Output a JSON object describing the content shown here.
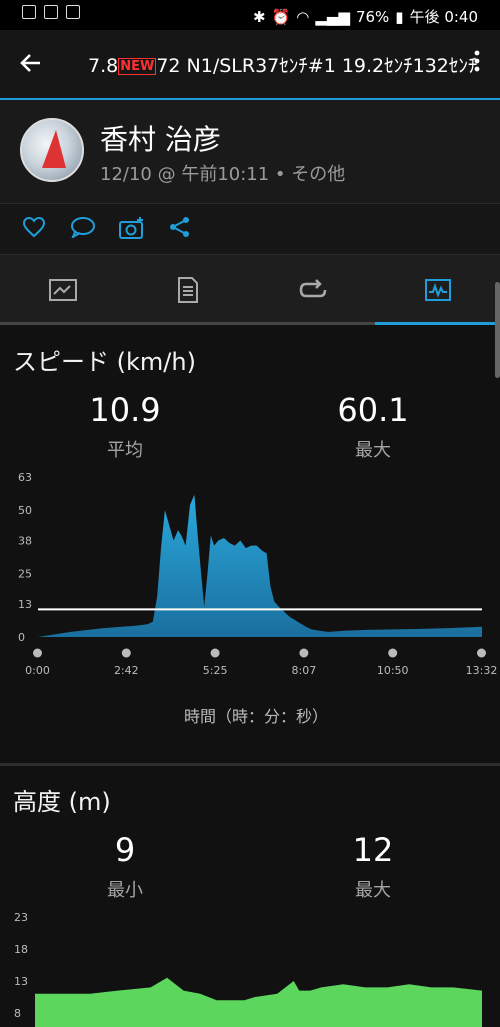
{
  "status_bar": {
    "battery": "76%",
    "time": "午後 0:40"
  },
  "app_bar": {
    "title_part1": "7.8",
    "new_tag": "NEW",
    "title_part2": "72 N1/SLR37ｾﾝﾁ#1 19.2ｾﾝﾁ132ｾﾝﾁ"
  },
  "activity": {
    "user_name": "香村 治彦",
    "meta": "12/10 @ 午前10:11 • その他"
  },
  "icons": {
    "back": "arrow-left-icon",
    "menu": "more-vert-icon",
    "like": "heart-icon",
    "comment": "comment-icon",
    "photo": "camera-add-icon",
    "share": "share-icon",
    "tab_summary": "map-summary-icon",
    "tab_details": "document-icon",
    "tab_laps": "laps-icon",
    "tab_charts": "chart-icon"
  },
  "speed": {
    "title": "スピード (km/h)",
    "avg_value": "10.9",
    "avg_label": "平均",
    "max_value": "60.1",
    "max_label": "最大",
    "x_axis_label": "時間（時：分：秒）"
  },
  "altitude": {
    "title": "高度 (m)",
    "min_value": "9",
    "min_label": "最小",
    "max_value": "12",
    "max_label": "最大"
  },
  "chart_data": [
    {
      "type": "area",
      "title": "スピード (km/h)",
      "xlabel": "時間（時：分：秒）",
      "ylabel": "",
      "x_ticks": [
        "0:00",
        "2:42",
        "5:25",
        "8:07",
        "10:50",
        "13:32"
      ],
      "y_ticks": [
        0,
        13,
        25,
        38,
        50,
        63
      ],
      "ylim": [
        0,
        63
      ],
      "xlim_seconds": [
        0,
        812
      ],
      "average_line": 10.9,
      "color": "#2aa8dc",
      "series": [
        {
          "x_seconds": [
            0,
            60,
            120,
            180,
            200,
            210,
            218,
            225,
            232,
            240,
            248,
            256,
            262,
            270,
            278,
            286,
            292,
            298,
            304,
            310,
            316,
            322,
            330,
            340,
            350,
            360,
            370,
            380,
            390,
            400,
            410,
            418,
            425,
            432,
            440,
            450,
            460,
            475,
            490,
            500,
            515,
            530,
            545,
            560,
            600,
            650,
            700,
            750,
            790,
            812
          ],
          "values": [
            0,
            2,
            3.5,
            4.5,
            5,
            6,
            16,
            35,
            50,
            44,
            38,
            42,
            40,
            36,
            52,
            56,
            40,
            26,
            12,
            25,
            40,
            36,
            38,
            39,
            37,
            36,
            38,
            35,
            36,
            36,
            34,
            33,
            20,
            14,
            12,
            10,
            8,
            6,
            4,
            3,
            2.5,
            2,
            2.2,
            2.5,
            2.8,
            3,
            3.2,
            3.5,
            3.8,
            4
          ]
        }
      ]
    },
    {
      "type": "area",
      "title": "高度 (m)",
      "y_ticks": [
        8,
        13,
        18,
        23
      ],
      "color": "#5cd65c",
      "series": [
        {
          "x_seconds": [
            0,
            100,
            150,
            210,
            240,
            270,
            300,
            330,
            380,
            400,
            440,
            470,
            480,
            500,
            520,
            560,
            600,
            640,
            680,
            720,
            760,
            812
          ],
          "values": [
            11,
            11,
            11.5,
            12,
            13.5,
            11.5,
            11,
            10,
            10,
            10.5,
            11,
            13,
            11.5,
            11.5,
            12,
            12.5,
            12,
            12,
            12.5,
            12,
            12,
            11.5
          ]
        }
      ]
    }
  ]
}
